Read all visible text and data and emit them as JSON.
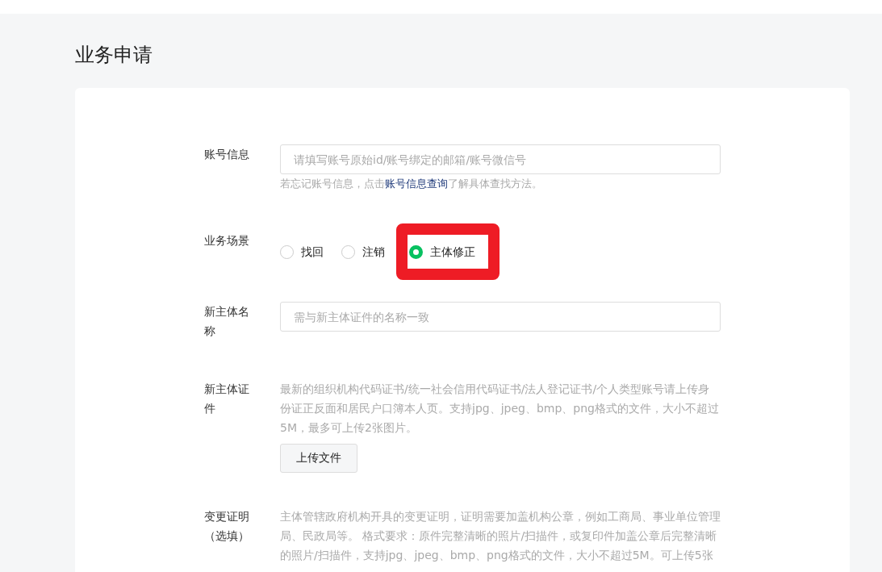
{
  "page_title": "业务申请",
  "form": [
    {
      "kind": "text",
      "label": "账号信息",
      "placeholder": "请填写账号原始id/账号绑定的邮箱/账号微信号",
      "hint": {
        "before": "若忘记账号信息，点击",
        "link": "账号信息查询",
        "after": "了解具体查找方法。"
      }
    },
    {
      "kind": "radio",
      "label": "业务场景",
      "options": [
        {
          "label": "找回",
          "selected": false,
          "highlighted": false
        },
        {
          "label": "注销",
          "selected": false,
          "highlighted": false
        },
        {
          "label": "主体修正",
          "selected": true,
          "highlighted": true
        }
      ]
    },
    {
      "kind": "text",
      "label": "新主体名称",
      "placeholder": "需与新主体证件的名称一致"
    },
    {
      "kind": "upload",
      "label": "新主体证件",
      "description": "最新的组织机构代码证书/统一社会信用代码证书/法人登记证书/个人类型账号请上传身份证正反面和居民户口簿本人页。支持jpg、jpeg、bmp、png格式的文件，大小不超过5M，最多可上传2张图片。",
      "button": "上传文件"
    },
    {
      "kind": "upload",
      "label": "变更证明（选填）",
      "description": "主体管辖政府机构开具的变更证明，证明需要加盖机构公章，例如工商局、事业单位管理局、民政局等。 格式要求：原件完整清晰的照片/扫描件，或复印件加盖公章后完整清晰的照片/扫描件，支持jpg、jpeg、bmp、png格式的文件，大小不超过5M。可上传5张"
    }
  ]
}
